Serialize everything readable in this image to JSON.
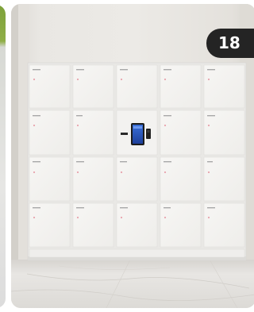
{
  "badge": {
    "number": "18"
  },
  "photo": {
    "subject": "locker-cabinet",
    "colors": {
      "wall": "#e7e5e1",
      "locker": "#f4f3f1",
      "floor": "#e4e2df",
      "indicator": "#e8a3ad",
      "badge_background": "#242424",
      "badge_text": "#ffffff"
    }
  }
}
